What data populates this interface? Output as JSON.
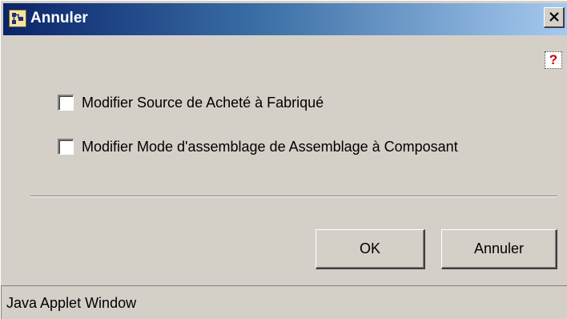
{
  "window": {
    "title": "Annuler",
    "title_gradient": [
      "#0a246a",
      "#3a6ea5",
      "#a6caf0"
    ],
    "background_color": "#d4d0c8",
    "close_icon": "close-icon",
    "app_icon": "java-app-icon"
  },
  "help": {
    "label": "?",
    "color": "#cc0000"
  },
  "options": [
    {
      "label": "Modifier Source de Acheté à Fabriqué",
      "checked": false
    },
    {
      "label": "Modifier Mode d'assemblage de Assemblage à Composant",
      "checked": false
    }
  ],
  "buttons": {
    "ok_label": "OK",
    "cancel_label": "Annuler"
  },
  "statusbar": {
    "text": "Java Applet Window"
  }
}
